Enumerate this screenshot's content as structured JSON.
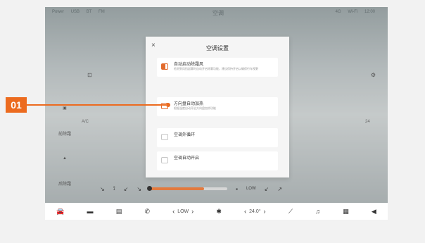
{
  "callout": {
    "label": "01"
  },
  "dialog": {
    "title": "空调设置",
    "close": "×",
    "options": [
      {
        "title": "自动启动除霜风",
        "desc": "检测到风挡起雾时自动开启除雾功能，建议保持开启以确保行车视野",
        "state": "on"
      },
      {
        "title": "方向盘自动加热",
        "desc": "根据温度自动开启方向盘加热功能",
        "state": "off"
      },
      {
        "title": "空调外循环",
        "desc": "",
        "state": "none"
      },
      {
        "title": "空调自动开启",
        "desc": "",
        "state": "none"
      }
    ]
  },
  "status_bar": {
    "left": [
      "Power",
      "USB",
      "BT",
      "FM"
    ],
    "center": "空调",
    "right": [
      "4G",
      "Wi-Fi",
      "12:00"
    ]
  },
  "background": {
    "left_text": "A/C",
    "right_text": "24",
    "side": [
      "前除霜",
      "后除霜"
    ]
  },
  "controls": {
    "mode": "LOW",
    "right_text": "LOW",
    "icons": [
      "seat-heat-icon",
      "fan-icon",
      "airflow-icon",
      "airflow-icon"
    ]
  },
  "bottom_bar": {
    "fan_level": "LOW",
    "temp": "24.0°",
    "fan_icon": "✱",
    "left_arrow": "‹",
    "right_arrow": "›",
    "music_icon": "♫",
    "grid_icon": "▦",
    "volume_icon": "◀"
  }
}
